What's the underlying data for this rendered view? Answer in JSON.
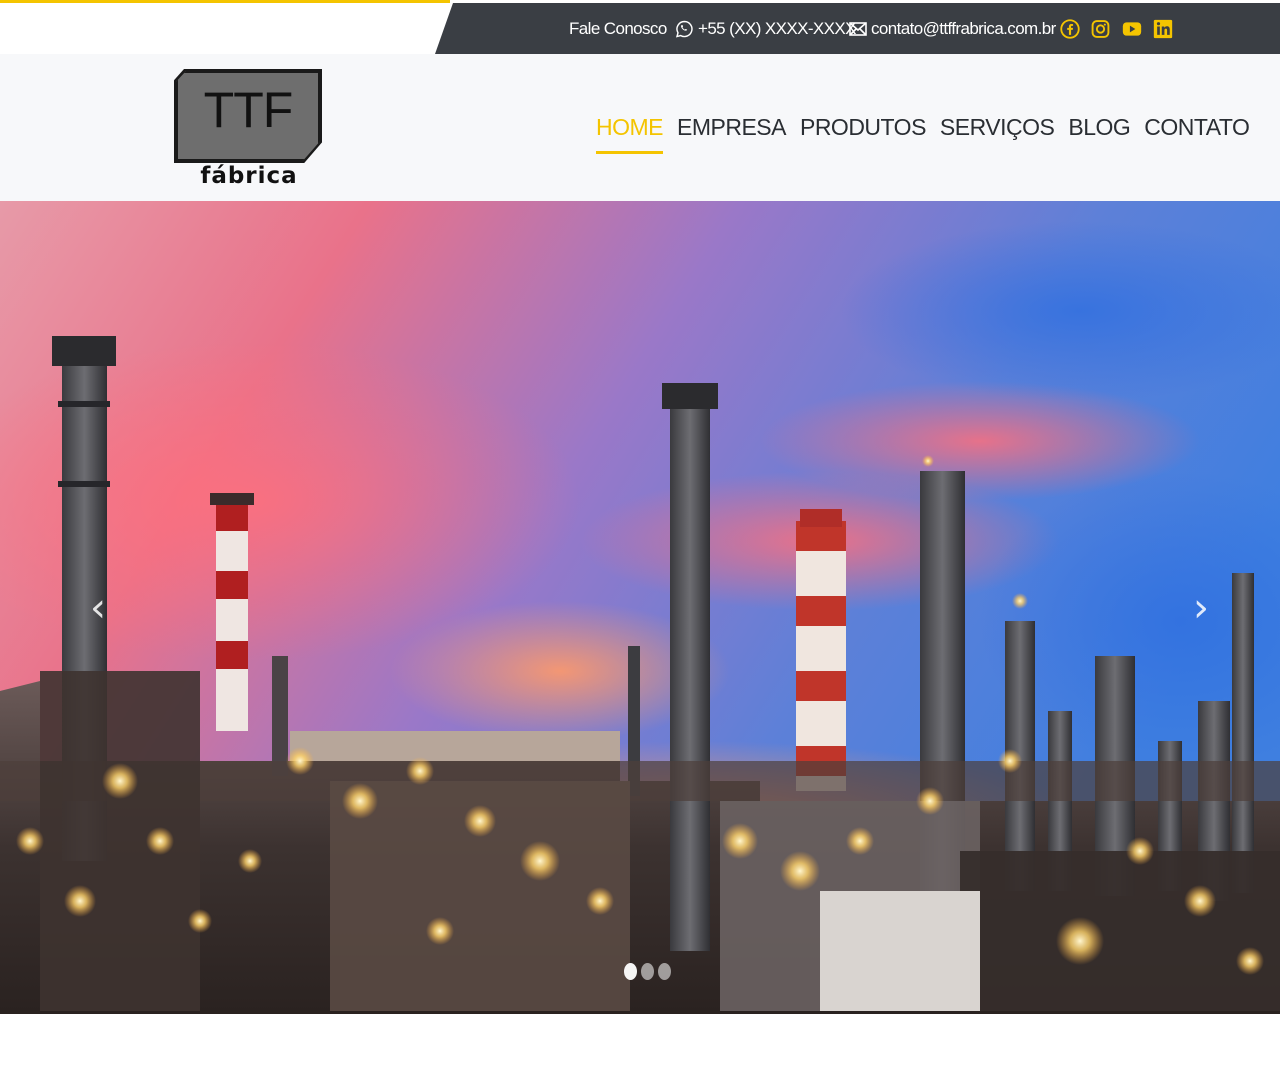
{
  "topbar": {
    "contact_label": "Fale Conosco",
    "phone": "+55 (XX) XXXX-XXXX",
    "email": "contato@ttffrabrica.com.br",
    "icons": {
      "phone": "whatsapp-icon",
      "email": "envelope-icon"
    },
    "social": [
      {
        "name": "facebook-icon"
      },
      {
        "name": "instagram-icon"
      },
      {
        "name": "youtube-icon"
      },
      {
        "name": "linkedin-icon"
      }
    ],
    "colors": {
      "background": "#3a3e44",
      "accent": "#f4c400",
      "text": "#ffffff"
    }
  },
  "logo": {
    "main": "TTF",
    "sub": "fábrica"
  },
  "nav": {
    "items": [
      {
        "label": "HOME",
        "active": true
      },
      {
        "label": "EMPRESA",
        "active": false
      },
      {
        "label": "PRODUTOS",
        "active": false
      },
      {
        "label": "SERVIÇOS",
        "active": false
      },
      {
        "label": "BLOG",
        "active": false
      },
      {
        "label": "CONTATO",
        "active": false
      }
    ],
    "colors": {
      "text": "#2a2e33",
      "active": "#f4c400"
    }
  },
  "hero": {
    "image": "industrial-refinery-at-dusk",
    "prev_arrow": "‹",
    "next_arrow": "›",
    "slides": 3,
    "active_slide": 1
  }
}
